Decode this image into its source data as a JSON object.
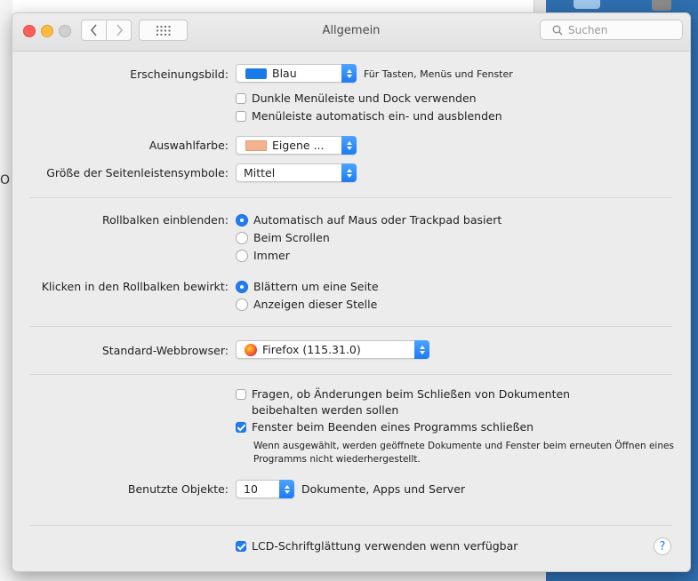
{
  "window": {
    "title": "Allgemein",
    "search_placeholder": "Suchen"
  },
  "background": {
    "left_char": "O"
  },
  "colors": {
    "accent": "#1f7cf2",
    "appearance_swatch": "#1a7be8",
    "highlight_swatch": "#f5b28f"
  },
  "icons": {
    "back": "chevron-left-icon",
    "forward": "chevron-right-icon",
    "grid": "grid-icon",
    "search": "search-icon",
    "browser": "firefox-icon",
    "help": "help-icon"
  },
  "appearance": {
    "label": "Erscheinungsbild:",
    "value": "Blau",
    "hint": "Für Tasten, Menüs und Fenster",
    "dark_menu": {
      "label": "Dunkle Menüleiste und Dock verwenden",
      "checked": false
    },
    "autohide_menu": {
      "label": "Menüleiste automatisch ein- und ausblenden",
      "checked": false
    }
  },
  "highlight": {
    "label": "Auswahlfarbe:",
    "value": "Eigene ..."
  },
  "sidebar_icons": {
    "label": "Größe der Seitenleistensymbole:",
    "value": "Mittel"
  },
  "scrollbars": {
    "label": "Rollbalken einblenden:",
    "options": [
      "Automatisch auf Maus oder Trackpad basiert",
      "Beim Scrollen",
      "Immer"
    ],
    "selected": 0
  },
  "scroll_click": {
    "label": "Klicken in den Rollbalken bewirkt:",
    "options": [
      "Blättern um eine Seite",
      "Anzeigen dieser Stelle"
    ],
    "selected": 0
  },
  "browser": {
    "label": "Standard-Webbrowser:",
    "value": "Firefox (115.31.0)"
  },
  "documents": {
    "ask_keep": {
      "label_line1": "Fragen, ob Änderungen beim Schließen von Dokumenten",
      "label_line2": "beibehalten werden sollen",
      "checked": false
    },
    "close_windows": {
      "label": "Fenster beim Beenden eines Programms schließen",
      "checked": true
    },
    "note_line1": "Wenn ausgewählt, werden geöffnete Dokumente und Fenster beim erneuten Öffnen eines",
    "note_line2": "Programms nicht wiederhergestellt."
  },
  "recent": {
    "label": "Benutzte Objekte:",
    "value": "10",
    "suffix": "Dokumente, Apps und Server"
  },
  "lcd": {
    "label": "LCD-Schriftglättung verwenden wenn verfügbar",
    "checked": true
  },
  "help": {
    "label": "?"
  }
}
